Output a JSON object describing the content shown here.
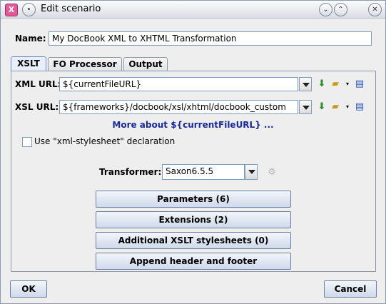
{
  "window": {
    "title": "Edit scenario",
    "app_icon_glyph": "X"
  },
  "name": {
    "label": "Name:",
    "value": "My DocBook XML to XHTML Transformation"
  },
  "tabs": [
    {
      "label": "XSLT",
      "active": true
    },
    {
      "label": "FO Processor",
      "active": false
    },
    {
      "label": "Output",
      "active": false
    }
  ],
  "xslt": {
    "xml_url": {
      "label": "XML URL:",
      "value": "${currentFileURL}"
    },
    "xsl_url": {
      "label": "XSL URL:",
      "value": "${frameworks}/docbook/xsl/xhtml/docbook_custom"
    },
    "more_link": "More about ${currentFileURL} ...",
    "use_xml_stylesheet": {
      "label": "Use \"xml-stylesheet\" declaration",
      "checked": false
    },
    "transformer": {
      "label": "Transformer:",
      "value": "Saxon6.5.5"
    },
    "buttons": {
      "parameters": "Parameters (6)",
      "extensions": "Extensions (2)",
      "additional": "Additional XSLT stylesheets (0)",
      "append": "Append header and footer"
    }
  },
  "footer": {
    "ok": "OK",
    "cancel": "Cancel"
  },
  "icons": [
    "app-icon",
    "menu-dot-icon",
    "minimize-icon",
    "maximize-icon",
    "close-icon",
    "download-icon",
    "folder-open-icon",
    "edit-file-icon",
    "settings-icon"
  ],
  "colors": {
    "accent": "#e35a9a",
    "link": "#1a2a9c",
    "button": "#cfd9ea"
  }
}
